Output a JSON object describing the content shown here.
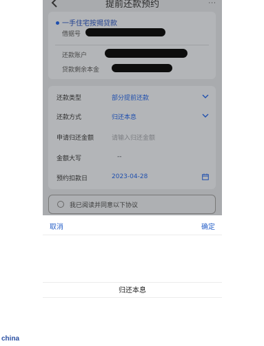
{
  "nav": {
    "title": "提前还款预约",
    "more": "···"
  },
  "loan": {
    "type": "一手住宅按揭贷款",
    "contract_label": "借据号",
    "account_label": "还款账户",
    "balance_label": "贷款剩余本金"
  },
  "form": {
    "repay_type_label": "还款类型",
    "repay_type_value": "部分提前还款",
    "repay_method_label": "还款方式",
    "repay_method_value": "归还本息",
    "amount_label": "申请归还金额",
    "amount_placeholder": "请输入归还金额",
    "amount_upper_label": "金额大写",
    "amount_upper_value": "--",
    "date_label": "预约扣款日",
    "date_value": "2023-04-28"
  },
  "agreement": {
    "text": "我已阅读并同意以下协议"
  },
  "picker": {
    "cancel": "取消",
    "confirm": "确定",
    "option": "归还本息"
  },
  "watermark": "china"
}
